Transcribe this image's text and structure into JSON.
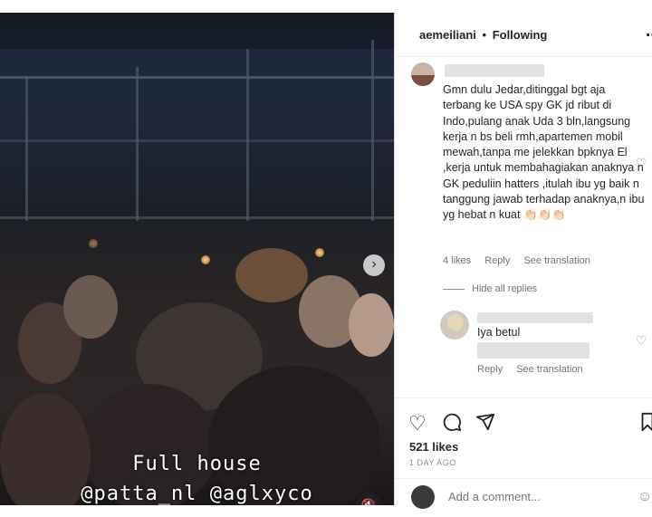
{
  "post": {
    "username": "aemeiliani",
    "separator": "•",
    "following_label": "Following",
    "more_icon": "more-horizontal-icon"
  },
  "media": {
    "overlay_line1": "Full house",
    "overlay_line2": "@patta_nl @aglxyco",
    "next_icon": "chevron-right-icon",
    "mute_icon": "muted-speaker-icon"
  },
  "comments": [
    {
      "text": "Gmn dulu Jedar,ditinggal bgt aja terbang ke USA spy GK jd ribut di Indo,pulang anak Uda 3 bln,langsung kerja n bs beli rmh,apartemen mobil mewah,tanpa me jelekkan bpknya El ,kerja untuk membahagiakan anaknya n GK peduliin hatters ,itulah ibu yg baik n tanggung jawab terhadap anaknya,n ibu yg hebat n kuat 👏🏻👏🏻👏🏻",
      "likes": "4 likes",
      "reply_label": "Reply",
      "translation_label": "See translation"
    }
  ],
  "replies_toggle": "Hide all replies",
  "reply": {
    "text": "Iya betul",
    "reply_label": "Reply",
    "translation_label": "See translation"
  },
  "actions": {
    "likes": "521 likes",
    "time_ago": "1 DAY AGO",
    "add_comment_placeholder": "Add a comment..."
  }
}
